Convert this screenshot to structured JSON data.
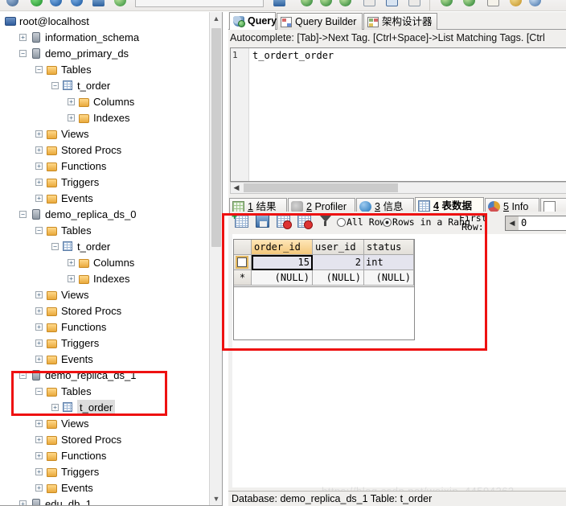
{
  "app": {
    "toolbar_icons": [
      "connect-icon",
      "new-query-icon",
      "refresh-icon",
      "stop-icon",
      "back-icon",
      "execute-icon",
      "forward-icon",
      "down-arrow-icon",
      "down-arrow2-icon",
      "down-arrow3-icon",
      "table-icon",
      "table-blue-icon",
      "grid-icon",
      "check-green-icon",
      "globe-icon",
      "book-icon",
      "gear-icon"
    ],
    "toolbar_combo_value": ""
  },
  "tree": {
    "root": "root@localhost",
    "items": [
      {
        "label": "root@localhost",
        "indent": 0,
        "expander": "",
        "icon": "pc-icon"
      },
      {
        "label": "information_schema",
        "indent": 1,
        "expander": "+",
        "icon": "server-icon"
      },
      {
        "label": "demo_primary_ds",
        "indent": 1,
        "expander": "−",
        "icon": "server-icon"
      },
      {
        "label": "Tables",
        "indent": 2,
        "expander": "−",
        "icon": "folder-icon"
      },
      {
        "label": "t_order",
        "indent": 3,
        "expander": "−",
        "icon": "table-icon"
      },
      {
        "label": "Columns",
        "indent": 4,
        "expander": "+",
        "icon": "folder-icon"
      },
      {
        "label": "Indexes",
        "indent": 4,
        "expander": "+",
        "icon": "folder-icon"
      },
      {
        "label": "Views",
        "indent": 2,
        "expander": "+",
        "icon": "folder-icon"
      },
      {
        "label": "Stored Procs",
        "indent": 2,
        "expander": "+",
        "icon": "folder-icon"
      },
      {
        "label": "Functions",
        "indent": 2,
        "expander": "+",
        "icon": "folder-icon"
      },
      {
        "label": "Triggers",
        "indent": 2,
        "expander": "+",
        "icon": "folder-icon"
      },
      {
        "label": "Events",
        "indent": 2,
        "expander": "+",
        "icon": "folder-icon"
      },
      {
        "label": "demo_replica_ds_0",
        "indent": 1,
        "expander": "−",
        "icon": "server-icon"
      },
      {
        "label": "Tables",
        "indent": 2,
        "expander": "−",
        "icon": "folder-icon"
      },
      {
        "label": "t_order",
        "indent": 3,
        "expander": "−",
        "icon": "table-icon"
      },
      {
        "label": "Columns",
        "indent": 4,
        "expander": "+",
        "icon": "folder-icon"
      },
      {
        "label": "Indexes",
        "indent": 4,
        "expander": "+",
        "icon": "folder-icon"
      },
      {
        "label": "Views",
        "indent": 2,
        "expander": "+",
        "icon": "folder-icon"
      },
      {
        "label": "Stored Procs",
        "indent": 2,
        "expander": "+",
        "icon": "folder-icon"
      },
      {
        "label": "Functions",
        "indent": 2,
        "expander": "+",
        "icon": "folder-icon"
      },
      {
        "label": "Triggers",
        "indent": 2,
        "expander": "+",
        "icon": "folder-icon"
      },
      {
        "label": "Events",
        "indent": 2,
        "expander": "+",
        "icon": "folder-icon"
      },
      {
        "label": "demo_replica_ds_1",
        "indent": 1,
        "expander": "−",
        "icon": "server-icon"
      },
      {
        "label": "Tables",
        "indent": 2,
        "expander": "−",
        "icon": "folder-icon"
      },
      {
        "label": "t_order",
        "indent": 3,
        "expander": "+",
        "icon": "table-icon",
        "selected": true
      },
      {
        "label": "Views",
        "indent": 2,
        "expander": "+",
        "icon": "folder-icon"
      },
      {
        "label": "Stored Procs",
        "indent": 2,
        "expander": "+",
        "icon": "folder-icon"
      },
      {
        "label": "Functions",
        "indent": 2,
        "expander": "+",
        "icon": "folder-icon"
      },
      {
        "label": "Triggers",
        "indent": 2,
        "expander": "+",
        "icon": "folder-icon"
      },
      {
        "label": "Events",
        "indent": 2,
        "expander": "+",
        "icon": "folder-icon"
      },
      {
        "label": "edu_db_1",
        "indent": 1,
        "expander": "+",
        "icon": "server-icon"
      }
    ]
  },
  "query_tabs": [
    {
      "label": "Query",
      "icon": "query-icon",
      "active": true
    },
    {
      "label": "Query Builder",
      "icon": "query-builder-icon",
      "active": false
    },
    {
      "label": "架构设计器",
      "icon": "schema-designer-icon",
      "active": false
    }
  ],
  "editor": {
    "hint": "Autocomplete: [Tab]->Next Tag. [Ctrl+Space]->List Matching Tags. [Ctrl",
    "line_numbers": [
      "1"
    ],
    "code": "t_ordert_order"
  },
  "result_tabs": [
    {
      "num": "1",
      "label": "结果",
      "icon": "result-grid-icon",
      "active": false
    },
    {
      "num": "2",
      "label": "Profiler",
      "icon": "profiler-icon",
      "active": false
    },
    {
      "num": "3",
      "label": "信息",
      "icon": "info-icon",
      "active": false
    },
    {
      "num": "4",
      "label": "表数据",
      "icon": "table-data-icon",
      "active": true
    },
    {
      "num": "5",
      "label": "Info",
      "icon": "chart-icon",
      "active": false
    },
    {
      "num": "",
      "label": "",
      "icon": "extra-tab-icon",
      "active": false
    }
  ],
  "grid_toolbar": {
    "icons": [
      "add-row-icon",
      "save-data-icon",
      "delete-row-icon",
      "delete-all-rows-icon",
      "filter-icon"
    ],
    "all_rows_label": "All Row:",
    "all_rows_selected": false,
    "range_rows_label": "Rows in a Rang",
    "range_rows_selected": true,
    "first_row_label_1": "First",
    "first_row_label_2": "Row:",
    "first_row_value": "0"
  },
  "data_grid": {
    "columns": [
      "order_id",
      "user_id",
      "status"
    ],
    "highlighted_column": "order_id",
    "rows": [
      {
        "marker": "checkbox",
        "cells": [
          "15",
          "2",
          "int"
        ]
      },
      {
        "marker": "*",
        "cells": [
          "(NULL)",
          "(NULL)",
          "(NULL)"
        ]
      }
    ],
    "selected_cell": "15"
  },
  "status_bar": {
    "text": "Database: demo_replica_ds_1 Table: t_order"
  },
  "watermark": {
    "text": "https://blog.csdn.net/weixin_44594263"
  },
  "annotations": {
    "color": "#ee1111",
    "boxes": [
      {
        "name": "tree-highlight-box"
      },
      {
        "name": "grid-highlight-box"
      }
    ]
  }
}
